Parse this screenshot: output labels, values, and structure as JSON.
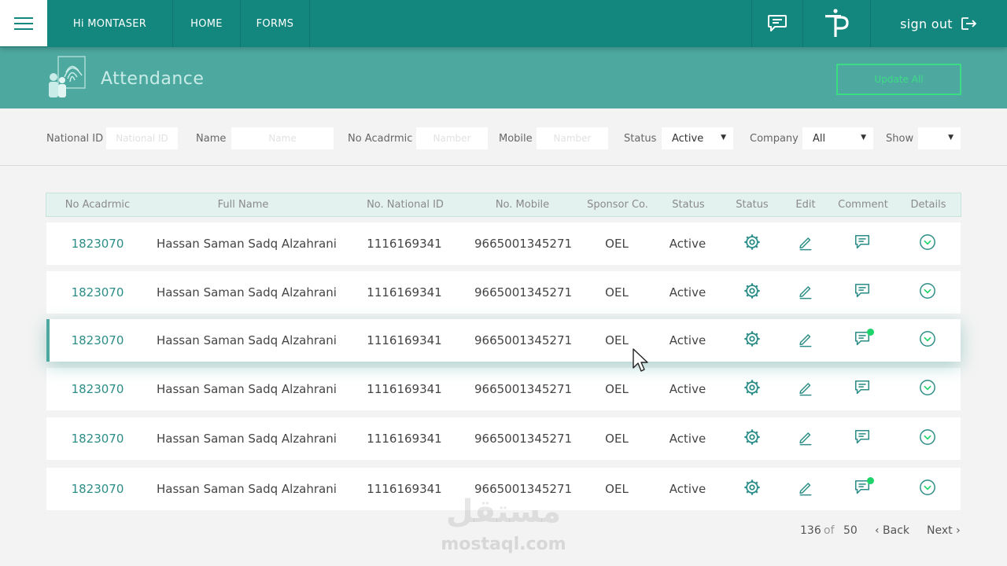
{
  "nav": {
    "greeting": "Hi MONTASER",
    "home": "HOME",
    "forms": "FORMS",
    "signout": "sign out"
  },
  "header": {
    "title": "Attendance",
    "update_all": "Update All"
  },
  "filters": {
    "national_id": {
      "label": "National ID",
      "placeholder": "National ID"
    },
    "name": {
      "label": "Name",
      "placeholder": "Name"
    },
    "academic": {
      "label": "No Acadrmic",
      "placeholder": "Namber"
    },
    "mobile": {
      "label": "Mobile",
      "placeholder": "Namber"
    },
    "status": {
      "label": "Status",
      "value": "Active"
    },
    "company": {
      "label": "Company",
      "value": "All"
    },
    "show": {
      "label": "Show",
      "value": ""
    }
  },
  "table": {
    "columns": [
      "No Acadrmic",
      "Full Name",
      "No. National ID",
      "No. Mobile",
      "Sponsor Co.",
      "Status",
      "Status",
      "Edit",
      "Comment",
      "Details"
    ],
    "rows": [
      {
        "academic": "1823070",
        "name": "Hassan Saman Sadq Alzahrani",
        "national_id": "1116169341",
        "mobile": "9665001345271",
        "sponsor": "OEL",
        "status": "Active",
        "has_new_comment": false
      },
      {
        "academic": "1823070",
        "name": "Hassan Saman Sadq Alzahrani",
        "national_id": "1116169341",
        "mobile": "9665001345271",
        "sponsor": "OEL",
        "status": "Active",
        "has_new_comment": false
      },
      {
        "academic": "1823070",
        "name": "Hassan Saman Sadq Alzahrani",
        "national_id": "1116169341",
        "mobile": "9665001345271",
        "sponsor": "OEL",
        "status": "Active",
        "has_new_comment": true
      },
      {
        "academic": "1823070",
        "name": "Hassan Saman Sadq Alzahrani",
        "national_id": "1116169341",
        "mobile": "9665001345271",
        "sponsor": "OEL",
        "status": "Active",
        "has_new_comment": false
      },
      {
        "academic": "1823070",
        "name": "Hassan Saman Sadq Alzahrani",
        "national_id": "1116169341",
        "mobile": "9665001345271",
        "sponsor": "OEL",
        "status": "Active",
        "has_new_comment": false
      },
      {
        "academic": "1823070",
        "name": "Hassan Saman Sadq Alzahrani",
        "national_id": "1116169341",
        "mobile": "9665001345271",
        "sponsor": "OEL",
        "status": "Active",
        "has_new_comment": true
      }
    ]
  },
  "pagination": {
    "current": "136",
    "of": "of",
    "total": "50",
    "back": "‹ Back",
    "next": "Next ›"
  },
  "watermark": {
    "arabic": "مستقل",
    "latin": "mostaql.com"
  },
  "icons": {
    "menu": "hamburger-icon",
    "chat": "chat-icon",
    "logo": "tp-logo",
    "signout": "sign-out-icon",
    "attendance": "fingerprint-people-icon",
    "status": "gear-icon",
    "edit": "pencil-icon",
    "comment": "comment-icon",
    "details": "chevron-down-circle-icon"
  },
  "colors": {
    "primary": "#13867e",
    "band": "#4da9a0",
    "accent": "#3ddc84",
    "link": "#2c8d86",
    "notify": "#1ed36a"
  }
}
